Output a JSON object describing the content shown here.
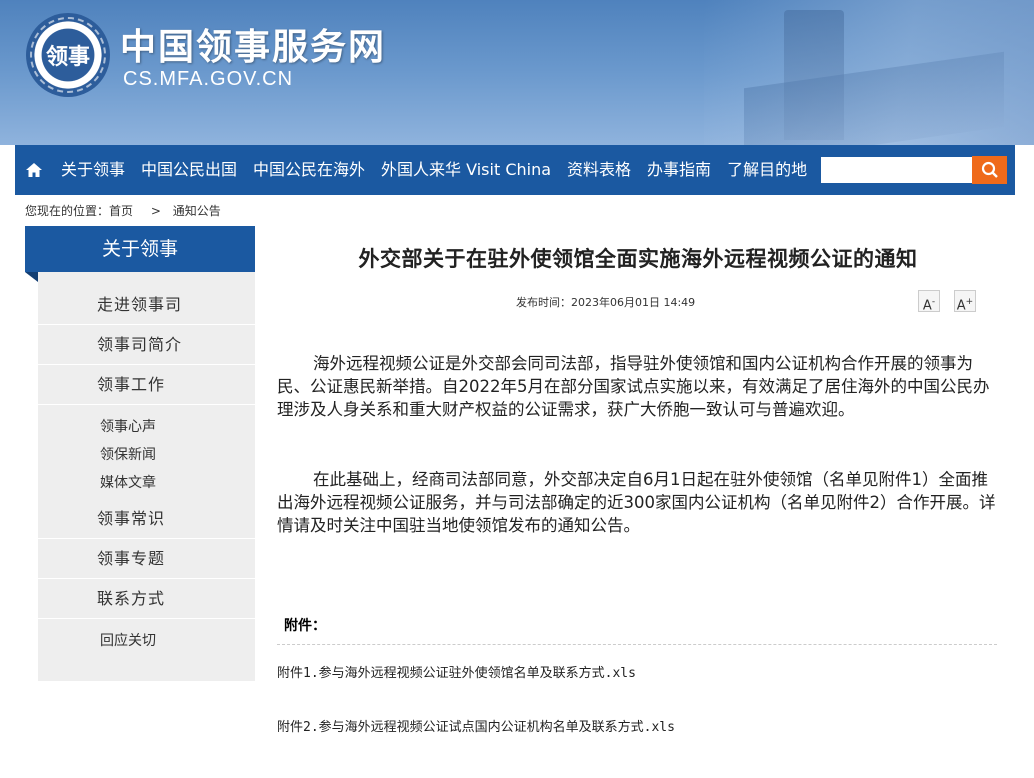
{
  "header": {
    "emblem_char": "领事",
    "title": "中国领事服务网",
    "url": "CS.MFA.GOV.CN"
  },
  "nav": {
    "home_icon": "home-icon",
    "items": [
      "关于领事",
      "中国公民出国",
      "中国公民在海外",
      "外国人来华 Visit China",
      "资料表格",
      "办事指南",
      "了解目的地"
    ],
    "search_value": "",
    "search_icon": "search-icon",
    "accent": "#ef6a1a",
    "bar_color": "#1b59a1"
  },
  "breadcrumb": {
    "prefix": "您现在的位置：",
    "home": "首页",
    "separator": ">",
    "current": "通知公告"
  },
  "sidebar": {
    "heading": "关于领事",
    "items": [
      "走进领事司",
      "领事司简介",
      "领事工作",
      "领事常识",
      "领事专题",
      "联系方式"
    ],
    "subitems": [
      "领事心声",
      "领保新闻",
      "媒体文章",
      "回应关切"
    ]
  },
  "article": {
    "title": "外交部关于在驻外使领馆全面实施海外远程视频公证的通知",
    "publish_label": "发布时间：2023年06月01日 14:49",
    "font_smaller": "A",
    "font_larger": "A",
    "paragraphs": [
      "海外远程视频公证是外交部会同司法部，指导驻外使领馆和国内公证机构合作开展的领事为民、公证惠民新举措。自2022年5月在部分国家试点实施以来，有效满足了居住海外的中国公民办理涉及人身关系和重大财产权益的公证需求，获广大侨胞一致认可与普遍欢迎。",
      "在此基础上，经商司法部同意，外交部决定自6月1日起在驻外使领馆（名单见附件1）全面推出海外远程视频公证服务，并与司法部确定的近300家国内公证机构（名单见附件2）合作开展。详情请及时关注中国驻当地使领馆发布的通知公告。"
    ],
    "attachments_label": "附件：",
    "attachments": [
      "附件1.参与海外远程视频公证驻外使领馆名单及联系方式.xls",
      "附件2.参与海外远程视频公证试点国内公证机构名单及联系方式.xls"
    ]
  }
}
